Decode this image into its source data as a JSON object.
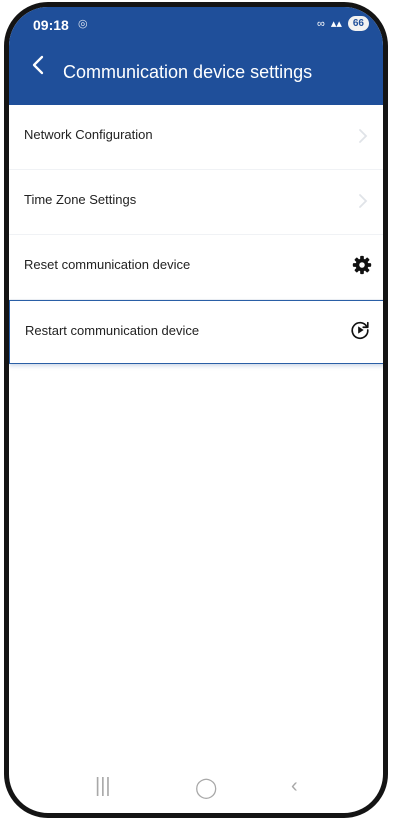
{
  "status_bar": {
    "time": "09:18",
    "battery": "66"
  },
  "header": {
    "title": "Communication device settings"
  },
  "menu": [
    {
      "label": "Network Configuration",
      "icon": "chevron-right-icon"
    },
    {
      "label": "Time Zone Settings",
      "icon": "chevron-right-icon"
    },
    {
      "label": "Reset communication device",
      "icon": "gear-icon"
    },
    {
      "label": "Restart communication device",
      "icon": "restart-icon"
    }
  ],
  "colors": {
    "primary": "#1f4f9a",
    "selection": "#2a5fa6"
  }
}
